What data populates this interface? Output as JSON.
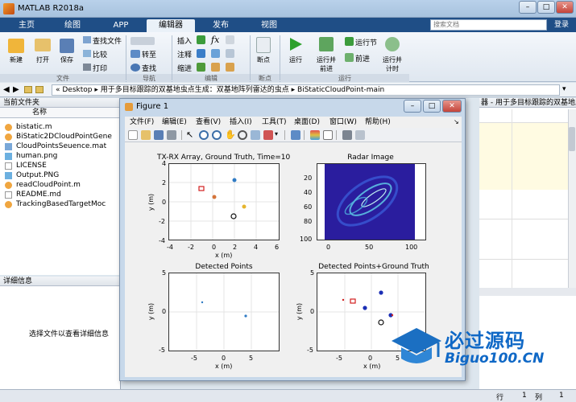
{
  "app": {
    "title": "MATLAB R2018a"
  },
  "tabs": [
    {
      "label": "主页"
    },
    {
      "label": "绘图"
    },
    {
      "label": "APP"
    },
    {
      "label": "编辑器"
    },
    {
      "label": "发布"
    },
    {
      "label": "视图"
    }
  ],
  "search": {
    "placeholder": "搜索文档"
  },
  "login_label": "登录",
  "ribbon": {
    "file_group": {
      "new": "新建",
      "open": "打开",
      "save": "保存",
      "find_files": "查找文件",
      "compare": "比较",
      "print": "打印",
      "label": "文件"
    },
    "nav_group": {
      "goto": "转至",
      "find": "查找",
      "label": "导航"
    },
    "edit_group": {
      "insert": "插入",
      "comment": "注释",
      "indent": "缩进",
      "label": "编辑"
    },
    "breakpoint_group": {
      "breakpoints": "断点",
      "label": "断点"
    },
    "run_group": {
      "run": "运行",
      "run_advance": "运行并\n前进",
      "run_section": "运行节",
      "advance": "前进",
      "run_time": "运行并\n计时",
      "label": "运行"
    }
  },
  "address": {
    "path": [
      "Desktop",
      "用于多目标跟踪的双基地虫点生成：双基地阵列雷达的虫点",
      "BiStaticCloudPoint-main"
    ]
  },
  "current_folder": {
    "title": "当前文件夹",
    "column": "名称",
    "files": [
      {
        "name": "bistatic.m",
        "icon": "m-file-icon"
      },
      {
        "name": "BiStatic2DCloudPointGene",
        "icon": "m-file-icon"
      },
      {
        "name": "CloudPointsSeuence.mat",
        "icon": "mat-file-icon"
      },
      {
        "name": "human.png",
        "icon": "image-file-icon"
      },
      {
        "name": "LICENSE",
        "icon": "doc-file-icon"
      },
      {
        "name": "Output.PNG",
        "icon": "image-file-icon"
      },
      {
        "name": "readCloudPoint.m",
        "icon": "m-file-icon"
      },
      {
        "name": "README.md",
        "icon": "doc-file-icon"
      },
      {
        "name": "TrackingBasedTargetMoc",
        "icon": "m-file-icon"
      }
    ]
  },
  "detail": {
    "title": "详细信息",
    "message": "选择文件以查看详细信息"
  },
  "right_panel_title": "器 - 用于多目标跟踪的双基地虫点生成：双基地阵列雷达的...",
  "status": {
    "row_label": "行",
    "row": "1",
    "col_label": "列",
    "col": "1"
  },
  "figure": {
    "title": "Figure 1",
    "menus": [
      "文件(F)",
      "编辑(E)",
      "查看(V)",
      "插入(I)",
      "工具(T)",
      "桌面(D)",
      "窗口(W)",
      "帮助(H)"
    ]
  },
  "plots": [
    {
      "title": "TX-RX Array, Ground Truth, Time=10",
      "xlabel": "x (m)",
      "ylabel": "y (m)",
      "xticks": [
        "-4",
        "-2",
        "0",
        "2",
        "4",
        "6"
      ],
      "yticks": [
        "4",
        "2",
        "0",
        "-2",
        "-4"
      ]
    },
    {
      "title": "Radar Image",
      "xticks": [
        "0",
        "50",
        "100"
      ],
      "yticks": [
        "20",
        "40",
        "60",
        "80",
        "100"
      ]
    },
    {
      "title": "Detected Points",
      "xlabel": "x (m)",
      "ylabel": "y (m)",
      "xticks": [
        "-5",
        "0",
        "5"
      ],
      "yticks": [
        "5",
        "0",
        "-5"
      ]
    },
    {
      "title": "Detected Points+Ground Truth",
      "xlabel": "x (m)",
      "ylabel": "y (m)",
      "xticks": [
        "-5",
        "0",
        "5"
      ],
      "yticks": [
        "5",
        "0",
        "-5"
      ]
    }
  ],
  "watermark": {
    "text_cn": "必过源码",
    "text_en": "Biguo100.CN"
  },
  "colors": {
    "ribbon_tab_bg": "#1f4e86",
    "radar_bg": "#2a1d9e",
    "accent": "#0f68c6",
    "marker_red": "#d21f1f"
  }
}
